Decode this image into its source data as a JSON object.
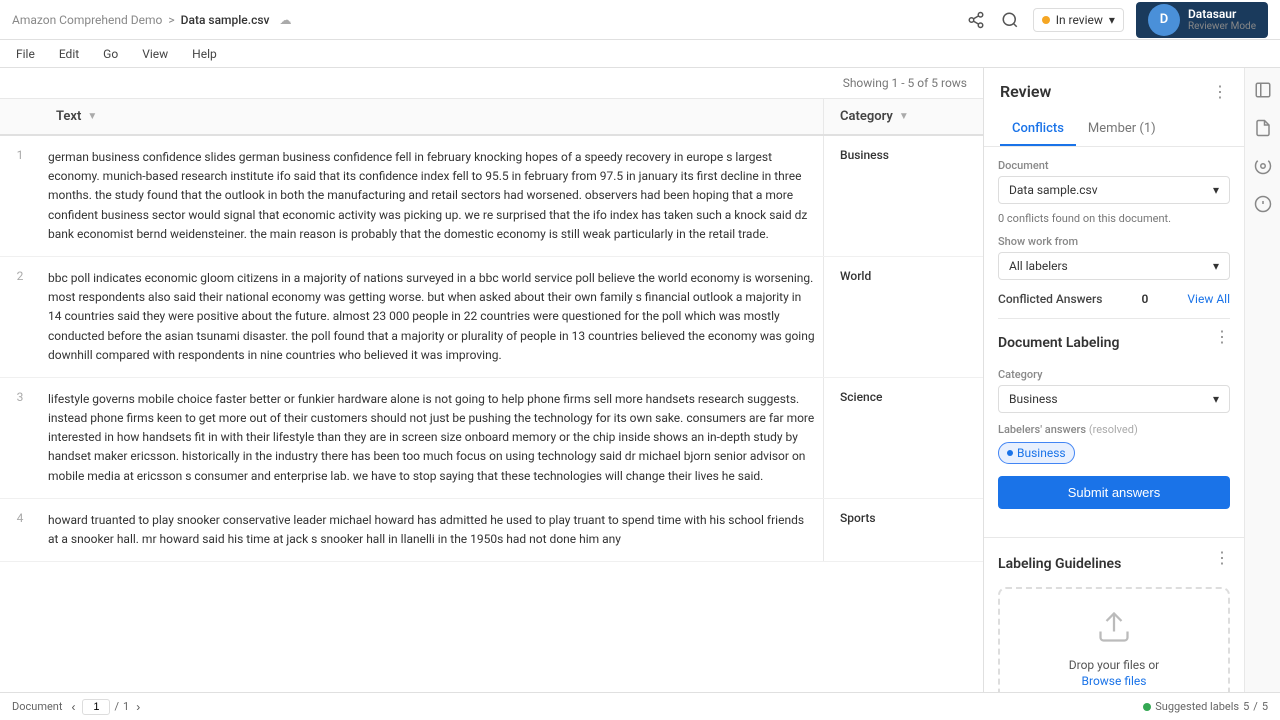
{
  "topbar": {
    "breadcrumb": {
      "root": "Amazon Comprehend Demo",
      "separator": ">",
      "file": "Data sample.csv"
    },
    "cloud_icon": "☁",
    "share_icon": "⬆",
    "search_icon": "🔍",
    "status_label": "In review",
    "chevron": "▾",
    "user": {
      "initials": "D",
      "name": "Datasaur",
      "role": "Reviewer Mode"
    }
  },
  "menu": {
    "items": [
      "File",
      "Edit",
      "Go",
      "View",
      "Help"
    ]
  },
  "table": {
    "showing_text": "Showing 1 - 5 of 5 rows",
    "col_text": "Text",
    "col_category": "Category",
    "rows": [
      {
        "num": "1",
        "text": "german business confidence slides german business confidence fell in february knocking hopes of a speedy recovery in europe s largest economy.  munich-based research institute ifo said that its confidence index fell to 95.5 in february from 97.5 in january  its first decline in three months. the study found that the outlook in both the manufacturing and retail sectors had worsened. observers had been hoping that a more confident business sector would signal that economic activity was picking up.   we re surprised that the ifo index has taken such a knock   said dz bank economist bernd weidensteiner.  the main reason is probably that the domestic economy is still weak particularly in the retail trade.",
        "category": "Business"
      },
      {
        "num": "2",
        "text": "bbc poll indicates economic gloom citizens in a majority of nations surveyed in a bbc world service poll believe the world economy is worsening.  most respondents also said their national economy was getting worse. but when asked about their own family s financial outlook  a majority in 14 countries said they were positive about the future. almost 23 000 people in 22 countries were questioned for the poll  which was mostly conducted before the asian tsunami disaster. the poll found that a majority or plurality of people in 13 countries believed the economy was going downhill  compared with respondents in nine countries who believed it was improving.",
        "category": "World"
      },
      {
        "num": "3",
        "text": "lifestyle  governs mobile choice  faster  better or funkier hardware alone is not going to help phone firms sell more handsets  research suggests.  instead  phone firms keen to get more out of their customers should not just be pushing the technology for its own sake. consumers are far more interested in how handsets fit in with their lifestyle than they are in screen size  onboard memory or the chip inside  shows an in-depth study by handset maker ericsson.  historically in the industry there has been too much focus on using technology   said dr michael bjorn  senior advisor on mobile media at ericsson s consumer and enterprise lab.  we have to stop saying that these technologies will change their lives   he said.",
        "category": "Science"
      },
      {
        "num": "4",
        "text": "howard  truanted to play snooker  conservative leader michael howard has admitted he used to play truant to spend time with his school friends at a snooker hall.  mr howard said his time at jack s snooker hall in llanelli in the 1950s had not done him  any",
        "category": "Sports"
      }
    ]
  },
  "review_panel": {
    "title": "Review",
    "more_icon": "⋮",
    "tabs": [
      {
        "label": "Conflicts",
        "active": true
      },
      {
        "label": "Member (1)",
        "active": false
      }
    ],
    "document_label": "Document",
    "document_value": "Data sample.csv",
    "conflicts_found": "0 conflicts found on this document.",
    "show_work_label": "Show work from",
    "show_work_value": "All labelers",
    "conflicted_answers_label": "Conflicted Answers",
    "conflicted_count": "0",
    "view_all": "View All",
    "doc_labeling_title": "Document Labeling",
    "category_label": "Category",
    "category_value": "Business",
    "labelers_answers_label": "Labelers' answers",
    "resolved_label": "(resolved)",
    "answer_badge": "Business",
    "submit_btn": "Submit answers",
    "labeling_guidelines_title": "Labeling Guidelines",
    "drop_text": "Drop your files or",
    "browse_text": "Browse files"
  },
  "bottom_bar": {
    "doc_label": "Document",
    "page_current": "1",
    "page_sep": "/",
    "page_total": "1",
    "suggested_labels": "Suggested labels",
    "suggested_count": "5",
    "sep": "/",
    "total_labels": "5"
  }
}
